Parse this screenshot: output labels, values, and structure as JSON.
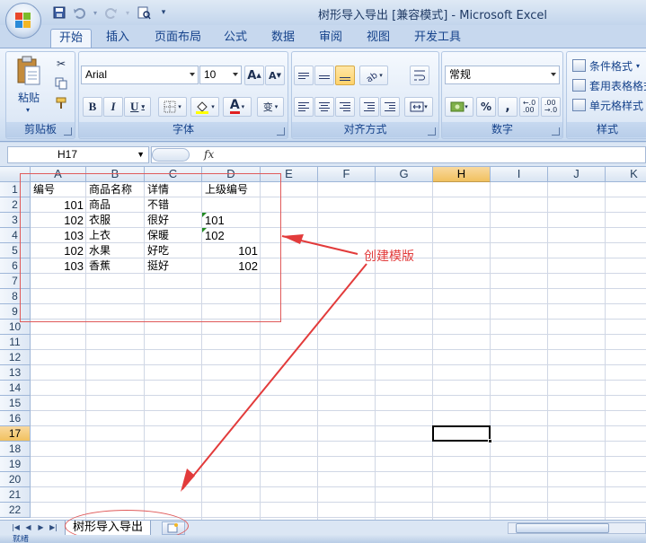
{
  "window": {
    "title": "树形导入导出  [兼容模式] - Microsoft Excel"
  },
  "ribbon_tabs": [
    "开始",
    "插入",
    "页面布局",
    "公式",
    "数据",
    "审阅",
    "视图",
    "开发工具"
  ],
  "ribbon": {
    "clipboard": {
      "paste_label": "粘贴",
      "group_label": "剪贴板"
    },
    "font": {
      "name": "Arial",
      "size": "10",
      "group_label": "字体"
    },
    "alignment": {
      "group_label": "对齐方式"
    },
    "number": {
      "format": "常规",
      "group_label": "数字",
      "percent": "%",
      "comma": ","
    },
    "styles": {
      "items": [
        "条件格式",
        "套用表格格式",
        "单元格样式"
      ],
      "group_label": "样式"
    }
  },
  "formula_bar": {
    "name_box": "H17",
    "fx_label": "fx",
    "formula": ""
  },
  "columns": [
    "A",
    "B",
    "C",
    "D",
    "E",
    "F",
    "G",
    "H",
    "I",
    "J",
    "K"
  ],
  "rows": [
    "1",
    "2",
    "3",
    "4",
    "5",
    "6",
    "7",
    "8",
    "9",
    "10",
    "11",
    "12",
    "13",
    "14",
    "15",
    "16",
    "17",
    "18",
    "19",
    "20",
    "21",
    "22"
  ],
  "selected_cell": "H17",
  "cells": {
    "r1": [
      "编号",
      "商品名称",
      "详情",
      "上级编号"
    ],
    "r2": [
      "101",
      "商品",
      "不错",
      ""
    ],
    "r3": [
      "102",
      "衣服",
      "很好",
      "101"
    ],
    "r4": [
      "103",
      "上衣",
      "保暖",
      "102"
    ],
    "r5": [
      "102",
      "水果",
      "好吃",
      "101"
    ],
    "r6": [
      "103",
      "香蕉",
      "挺好",
      "102"
    ]
  },
  "annotation": {
    "text": "创建模版"
  },
  "sheets": [
    "树形导入导出"
  ],
  "status_bar": {
    "text": "就绪"
  }
}
